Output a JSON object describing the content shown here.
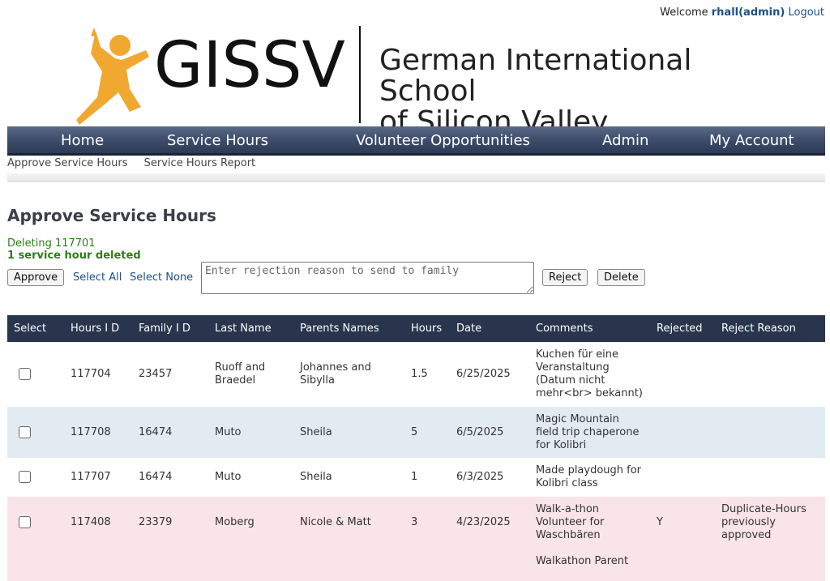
{
  "header": {
    "welcome_prefix": "Welcome",
    "user": "rhall(admin)",
    "logout": "Logout",
    "logo_text": "GISSV",
    "school_line1": "German International School",
    "school_line2": "of Silicon Valley"
  },
  "nav": {
    "items": [
      "Home",
      "Service Hours",
      "Volunteer Opportunities",
      "Admin",
      "My Account"
    ]
  },
  "subnav": {
    "items": [
      "Approve Service Hours",
      "Service Hours Report"
    ]
  },
  "page": {
    "title": "Approve Service Hours",
    "status_line1": "Deleting 117701",
    "status_line2": "1 service hour deleted"
  },
  "controls": {
    "approve": "Approve",
    "select_all": "Select All",
    "select_none": "Select None",
    "reason_placeholder": "Enter rejection reason to send to family",
    "reject": "Reject",
    "delete": "Delete"
  },
  "table": {
    "columns": [
      "Select",
      "Hours I D",
      "Family I D",
      "Last Name",
      "Parents Names",
      "Hours",
      "Date",
      "Comments",
      "Rejected",
      "Reject Reason"
    ],
    "rows": [
      {
        "hours_id": "117704",
        "family_id": "23457",
        "last_name": "Ruoff and Braedel",
        "parents": "Johannes and Sibylla",
        "hours": "1.5",
        "date": "6/25/2025",
        "comments": "Kuchen für eine Veranstaltung (Datum nicht mehr<br> bekannt)",
        "rejected": "",
        "reason": ""
      },
      {
        "hours_id": "117708",
        "family_id": "16474",
        "last_name": "Muto",
        "parents": "Sheila",
        "hours": "5",
        "date": "6/5/2025",
        "comments": "Magic Mountain field trip chaperone for Kolibri",
        "rejected": "",
        "reason": ""
      },
      {
        "hours_id": "117707",
        "family_id": "16474",
        "last_name": "Muto",
        "parents": "Sheila",
        "hours": "1",
        "date": "6/3/2025",
        "comments": "Made playdough for Kolibri class",
        "rejected": "",
        "reason": ""
      },
      {
        "hours_id": "117408",
        "family_id": "23379",
        "last_name": "Moberg",
        "parents": "Nicole & Matt",
        "hours": "3",
        "date": "4/23/2025",
        "comments": "Walk-a-thon Volunteer for Waschbären",
        "rejected": "Y",
        "reason": "Duplicate-Hours previously approved"
      },
      {
        "hours_id": "",
        "family_id": "",
        "last_name": "",
        "parents": "",
        "hours": "",
        "date": "",
        "comments": "Walkathon Parent",
        "rejected": "",
        "reason": ""
      }
    ]
  },
  "colors": {
    "nav_bg": "#3f4f6d",
    "header_bg": "#28354d",
    "link": "#1c4f86",
    "success": "#2e7d1a",
    "row_blue": "#e3ebf2",
    "row_pink": "#f9e4ea",
    "logo_orange": "#f0a830"
  }
}
